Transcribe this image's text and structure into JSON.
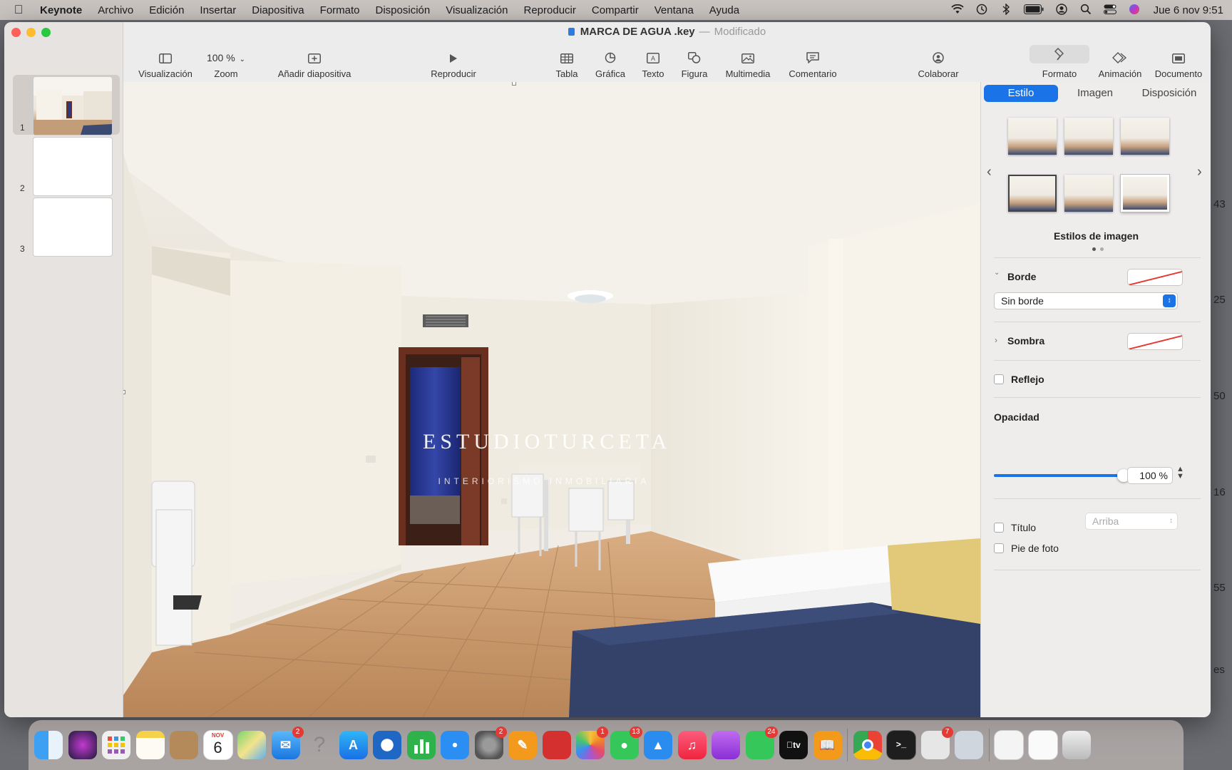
{
  "menubar": {
    "app": "Keynote",
    "items": [
      "Archivo",
      "Edición",
      "Insertar",
      "Diapositiva",
      "Formato",
      "Disposición",
      "Visualización",
      "Reproducir",
      "Compartir",
      "Ventana",
      "Ayuda"
    ],
    "clock": "Jue 6 nov  9:51"
  },
  "window": {
    "doc_name": "MARCA DE AGUA .key",
    "separator": "—",
    "status": "Modificado"
  },
  "toolbar": {
    "view": "Visualización",
    "zoom_value": "100 %",
    "zoom": "Zoom",
    "add_slide": "Añadir diapositiva",
    "play": "Reproducir",
    "table": "Tabla",
    "chart": "Gráfica",
    "text": "Texto",
    "shape": "Figura",
    "media": "Multimedia",
    "comment": "Comentario",
    "collaborate": "Colaborar",
    "format": "Formato",
    "animate": "Animación",
    "document": "Documento"
  },
  "slides": [
    {
      "number": "1",
      "selected": true
    },
    {
      "number": "2",
      "selected": false
    },
    {
      "number": "3",
      "selected": false
    }
  ],
  "watermark": {
    "title": "ESTUDIOTURCETA",
    "subtitle": "INTERIORISMO INMOBILIARIA"
  },
  "inspector": {
    "tabs": [
      "Estilo",
      "Imagen",
      "Disposición"
    ],
    "active_tab": "Estilo",
    "styles_label": "Estilos de imagen",
    "border_label": "Borde",
    "border_value": "Sin borde",
    "shadow_label": "Sombra",
    "reflection_label": "Reflejo",
    "opacity_label": "Opacidad",
    "opacity_value": "100 %",
    "opacity_fraction": 1.0,
    "title_label": "Título",
    "title_position": "Arriba",
    "caption_label": "Pie de foto"
  },
  "edge_numbers": [
    "43",
    "25",
    "50",
    "16",
    "55",
    "es"
  ],
  "dock": {
    "calendar_month": "NOV",
    "calendar_day": "6",
    "badges": {
      "mail": "2",
      "settings": "2",
      "photos": "1",
      "messages": "13",
      "facetime": "24",
      "extra": "7"
    },
    "apps": [
      "finder-icon",
      "siri-icon",
      "launchpad-icon",
      "notes-icon",
      "contacts-icon",
      "calendar-icon",
      "maps-icon",
      "mail-icon",
      "help-icon",
      "app-store-icon",
      "thunderbird-icon",
      "numbers-icon",
      "safari-icon",
      "system-settings-icon",
      "pages-icon",
      "photo-booth-icon",
      "photos-icon",
      "messages-icon",
      "keynote-icon",
      "music-icon",
      "podcasts-icon",
      "facetime-icon",
      "apple-tv-icon",
      "books-icon",
      "chrome-icon",
      "terminal-icon",
      "preview-icon",
      "image-capture-icon",
      "documents-icon",
      "downloads-icon",
      "trash-icon"
    ]
  }
}
